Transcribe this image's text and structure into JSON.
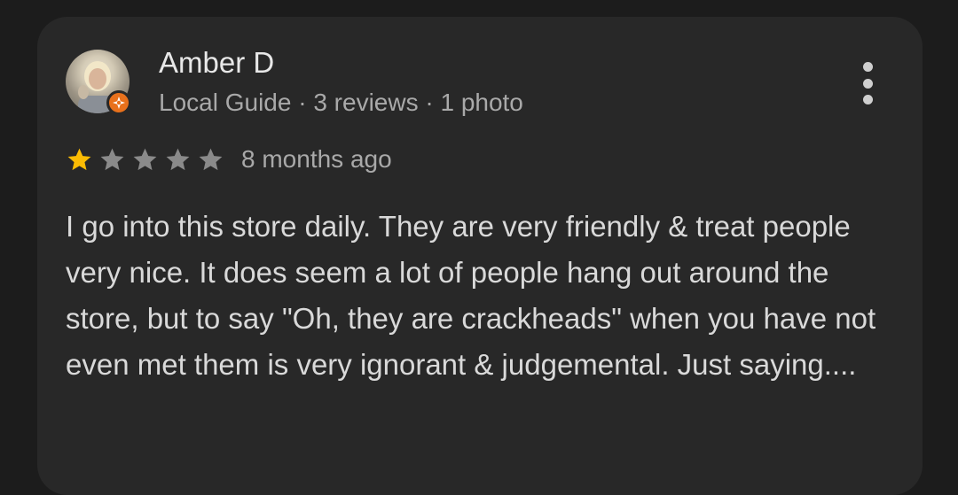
{
  "review": {
    "author_name": "Amber D",
    "author_meta": "Local Guide · 3 reviews · 1 photo",
    "rating": 1,
    "max_rating": 5,
    "time_ago": "8 months ago",
    "text": "I go into this store daily. They are very friendly & treat people very nice. It does seem a lot of people hang out around the store, but to say \"Oh, they are crackheads\" when you have not even met them is very ignorant & judgemental. Just saying...."
  },
  "icons": {
    "avatar": "user-avatar",
    "badge": "local-guide-badge-icon",
    "more": "more-vert-icon",
    "star_filled": "star-filled-icon",
    "star_empty": "star-empty-icon"
  },
  "colors": {
    "background": "#1c1c1c",
    "card": "#282828",
    "star_filled": "#fbbc04",
    "star_empty": "#8a8a8a",
    "badge": "#e8711c"
  }
}
